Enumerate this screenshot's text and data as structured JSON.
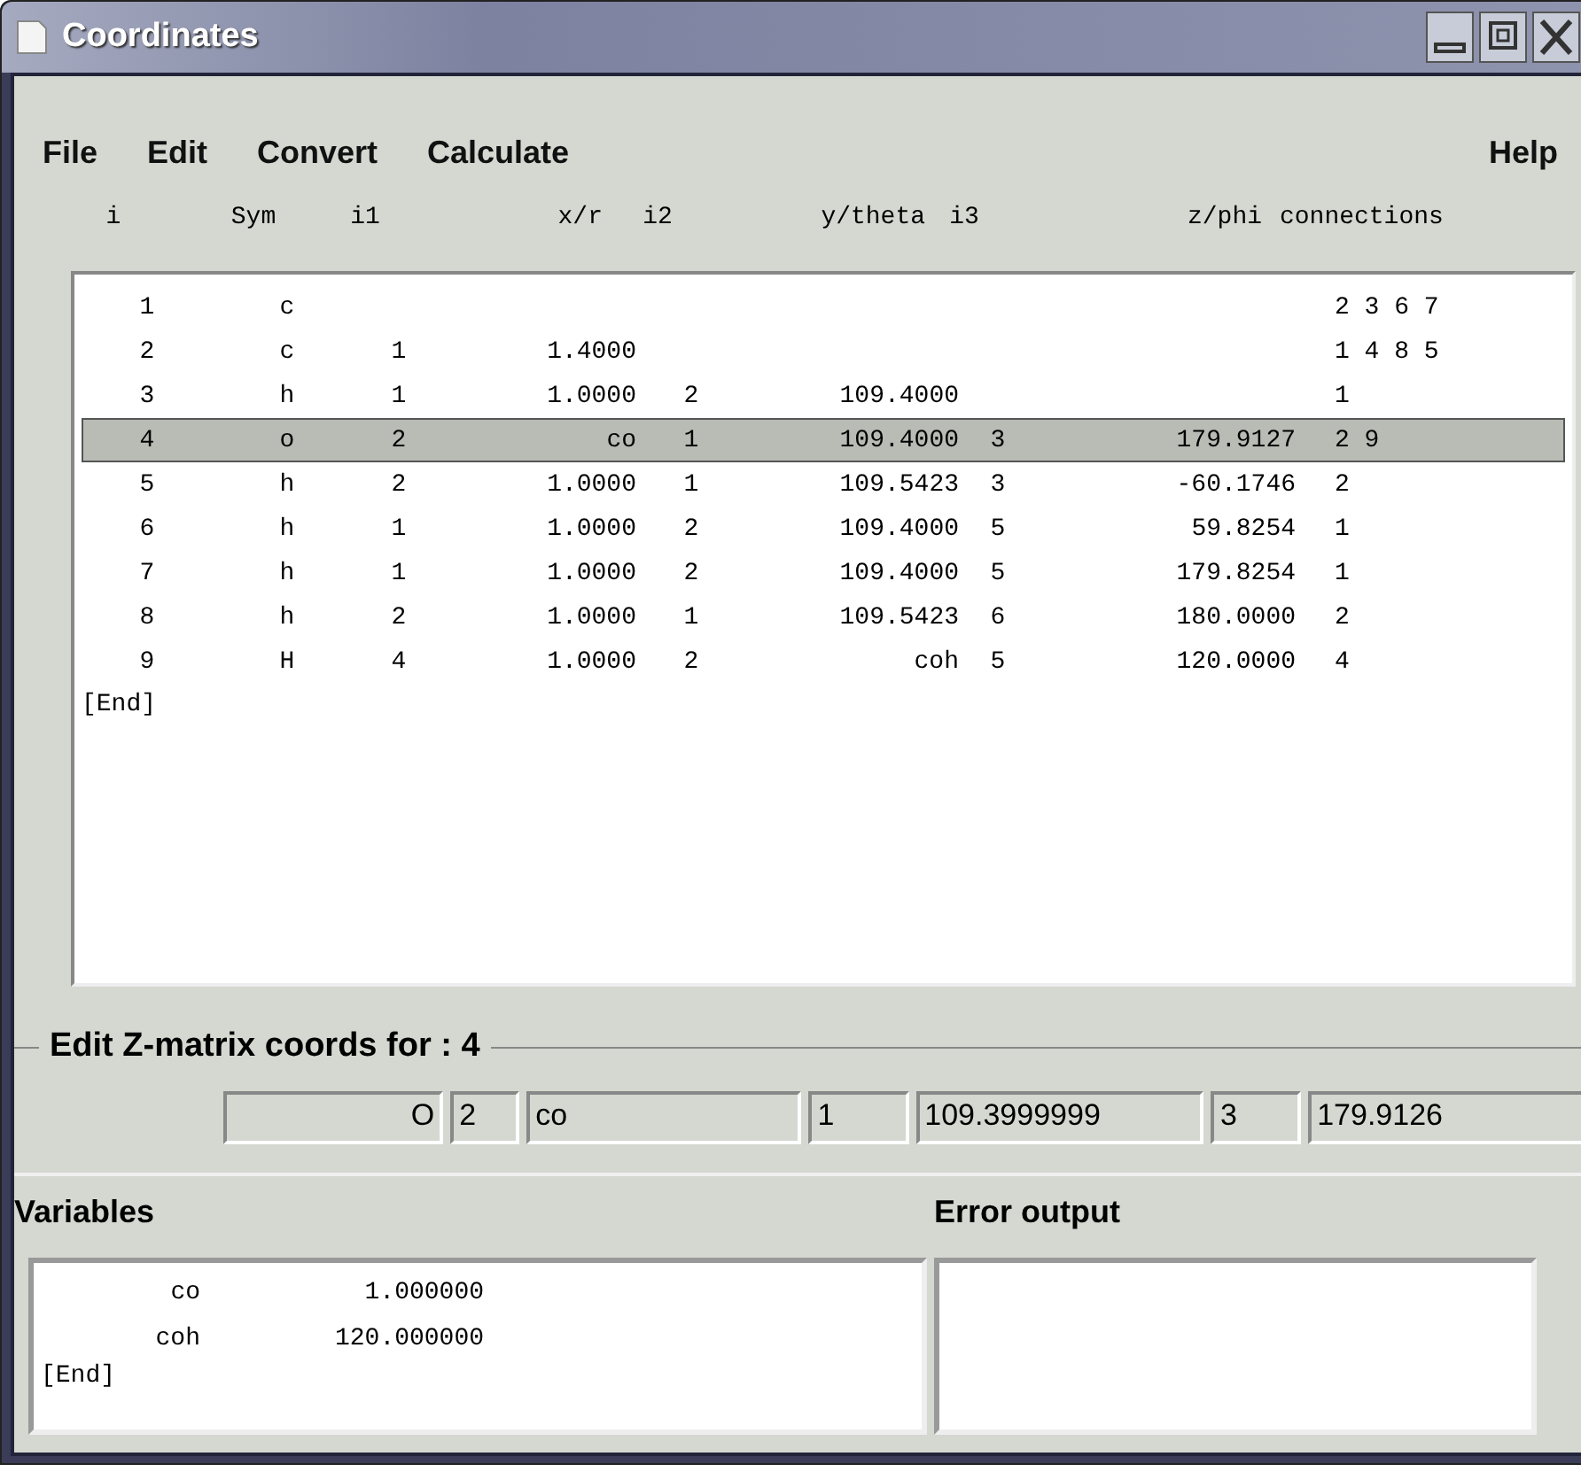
{
  "window": {
    "title": "Coordinates"
  },
  "menu": [
    {
      "label": "File",
      "kind": "main"
    },
    {
      "label": "Edit",
      "kind": "main"
    },
    {
      "label": "Convert",
      "kind": "main"
    },
    {
      "label": "Calculate",
      "kind": "main"
    },
    {
      "label": "Help",
      "kind": "help"
    }
  ],
  "table": {
    "columns": [
      "i",
      "Sym",
      "i1",
      "x/r",
      "i2",
      "y/theta",
      "i3",
      "z/phi",
      "connections"
    ],
    "rows": [
      {
        "i": "1",
        "sym": "c",
        "connections": "2 3 6 7",
        "selected": false
      },
      {
        "i": "2",
        "sym": "c",
        "i1": "1",
        "x_r": "1.4000",
        "connections": "1 4 8 5",
        "selected": false
      },
      {
        "i": "3",
        "sym": "h",
        "i1": "1",
        "x_r": "1.0000",
        "i2": "2",
        "y_theta": "109.4000",
        "connections": "1",
        "selected": false
      },
      {
        "i": "4",
        "sym": "o",
        "i1": "2",
        "x_r": "co",
        "i2": "1",
        "y_theta": "109.4000",
        "i3": "3",
        "z_phi": "179.9127",
        "connections": "2 9",
        "selected": true
      },
      {
        "i": "5",
        "sym": "h",
        "i1": "2",
        "x_r": "1.0000",
        "i2": "1",
        "y_theta": "109.5423",
        "i3": "3",
        "z_phi": "-60.1746",
        "connections": "2",
        "selected": false
      },
      {
        "i": "6",
        "sym": "h",
        "i1": "1",
        "x_r": "1.0000",
        "i2": "2",
        "y_theta": "109.4000",
        "i3": "5",
        "z_phi": "59.8254",
        "connections": "1",
        "selected": false
      },
      {
        "i": "7",
        "sym": "h",
        "i1": "1",
        "x_r": "1.0000",
        "i2": "2",
        "y_theta": "109.4000",
        "i3": "5",
        "z_phi": "179.8254",
        "connections": "1",
        "selected": false
      },
      {
        "i": "8",
        "sym": "h",
        "i1": "2",
        "x_r": "1.0000",
        "i2": "1",
        "y_theta": "109.5423",
        "i3": "6",
        "z_phi": "180.0000",
        "connections": "2",
        "selected": false
      },
      {
        "i": "9",
        "sym": "H",
        "i1": "4",
        "x_r": "1.0000",
        "i2": "2",
        "y_theta": "coh",
        "i3": "5",
        "z_phi": "120.0000",
        "connections": "4",
        "selected": false
      }
    ],
    "end_marker": "[End]"
  },
  "edit_frame": {
    "title": "Edit Z-matrix coords for : 4",
    "fields": [
      {
        "value": "O",
        "kind": "readonly"
      },
      {
        "value": "2",
        "kind": "narrow"
      },
      {
        "value": "co",
        "kind": "wide"
      },
      {
        "value": "1",
        "kind": "narrow"
      },
      {
        "value": "109.3999999",
        "kind": "wide"
      },
      {
        "value": "3",
        "kind": "narrow"
      },
      {
        "value": "179.9126",
        "kind": "wide"
      }
    ]
  },
  "variables": {
    "title": "Variables",
    "items": [
      {
        "name": "co",
        "value": "1.000000"
      },
      {
        "name": "coh",
        "value": "120.000000"
      }
    ],
    "end_marker": "[End]"
  },
  "error_output": {
    "title": "Error output"
  }
}
